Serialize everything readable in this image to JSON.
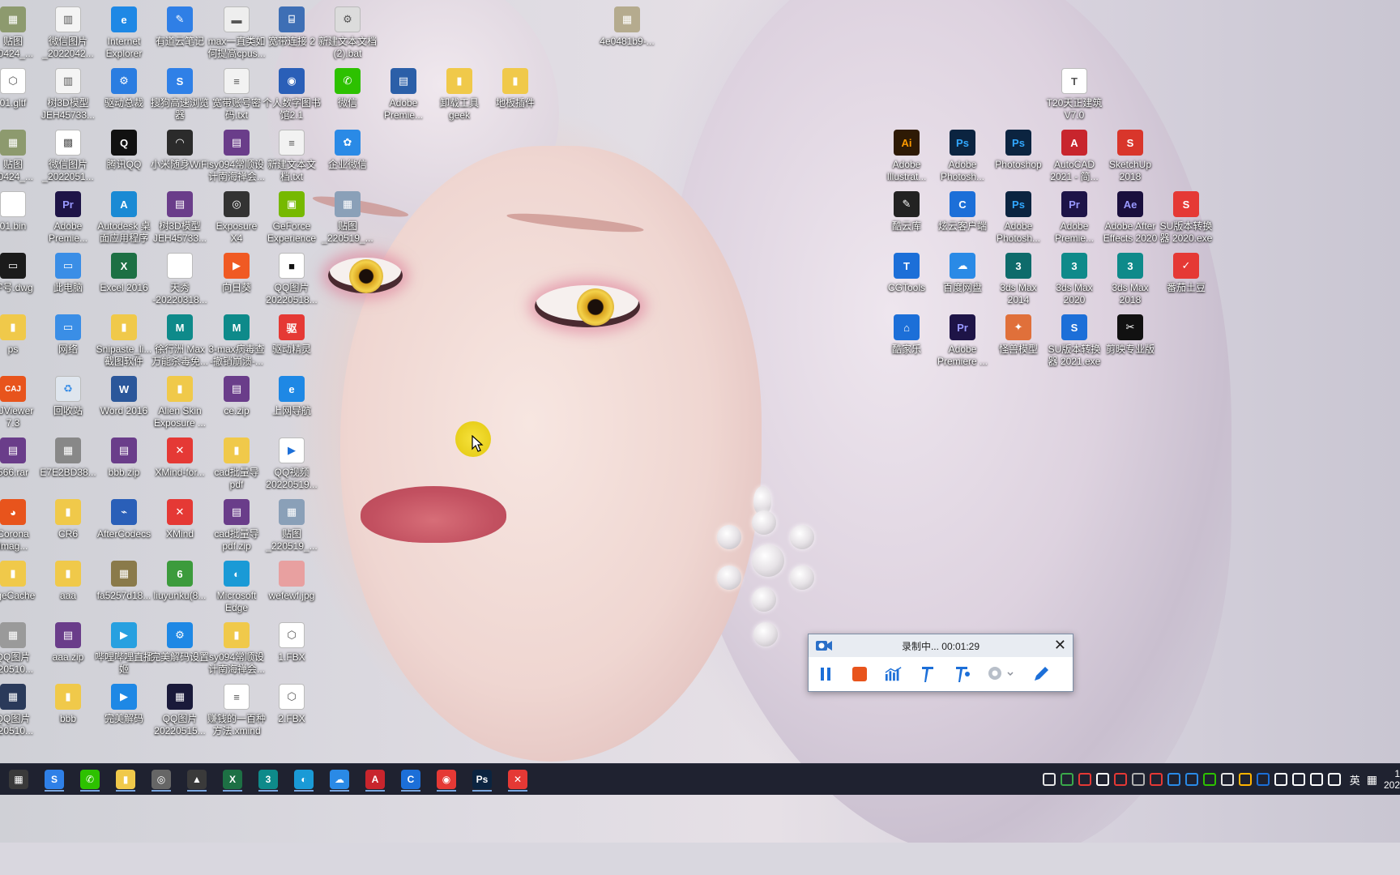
{
  "desktop": {
    "icons": [
      {
        "id": "tietu-1",
        "label": "贴图\n20424_...",
        "color": "#8d9a6e",
        "glyph": "▦"
      },
      {
        "id": "wx-img-1",
        "label": "微信图片\n_2022042...",
        "color": "#f4f4f4",
        "glyph": "▥"
      },
      {
        "id": "ie",
        "label": "Internet\nExplorer",
        "color": "#1e88e5",
        "glyph": "e"
      },
      {
        "id": "youdao",
        "label": "有道云笔记",
        "color": "#2f7fe6",
        "glyph": "✎"
      },
      {
        "id": "max-cpu",
        "label": "max一直类如\n何提高cpus...",
        "color": "#eeeeee",
        "glyph": "▬"
      },
      {
        "id": "broadband2",
        "label": "宽带连接 2",
        "color": "#3e6fb5",
        "glyph": "⌸"
      },
      {
        "id": "new-bat",
        "label": "新建文本文档\n(2).bat",
        "color": "#dcdcdc",
        "glyph": "⚙"
      },
      {
        "id": "hash-img",
        "label": "4e0481b9-...",
        "color": "#b5ab8e",
        "glyph": "▦"
      },
      {
        "id": "gltf",
        "label": "01.gltf",
        "color": "#ffffff",
        "glyph": "⬡"
      },
      {
        "id": "tree3d-1",
        "label": "树3D模型\nJEH45733...",
        "color": "#f4f4f4",
        "glyph": "▥"
      },
      {
        "id": "driver-master",
        "label": "驱动总裁",
        "color": "#2a7de1",
        "glyph": "⚙"
      },
      {
        "id": "sogou-browser",
        "label": "搜狗高速浏览\n器",
        "color": "#2f80e7",
        "glyph": "S"
      },
      {
        "id": "broadband-pw",
        "label": "宽带账号密\n码.txt",
        "color": "#f2f2f2",
        "glyph": "≡"
      },
      {
        "id": "personal-lib",
        "label": "个人数字图书\n馆2.1",
        "color": "#2a5fb8",
        "glyph": "◉"
      },
      {
        "id": "wechat",
        "label": "微信",
        "color": "#2dc100",
        "glyph": "✆"
      },
      {
        "id": "premiere-a",
        "label": "Adobe\nPremie...",
        "color": "#2b5fa8",
        "glyph": "▤"
      },
      {
        "id": "geek",
        "label": "卸载工具\ngeek",
        "color": "#f0c94a",
        "glyph": "▮"
      },
      {
        "id": "floor-pack",
        "label": "地板插件",
        "color": "#f0c94a",
        "glyph": "▮"
      },
      {
        "id": "t20",
        "label": "T20天正建筑\nV7.0",
        "color": "#ffffff",
        "glyph": "T"
      },
      {
        "id": "tietu-2",
        "label": "贴图\n20424_...",
        "color": "#8d9a6e",
        "glyph": "▦"
      },
      {
        "id": "wx-img-2",
        "label": "微信图片\n_2022051...",
        "color": "#ffffff",
        "glyph": "▩"
      },
      {
        "id": "qq",
        "label": "腾讯QQ",
        "color": "#111111",
        "glyph": "Q"
      },
      {
        "id": "mi-wifi",
        "label": "小米随身WiFi",
        "color": "#2b2b2b",
        "glyph": "◠"
      },
      {
        "id": "sy094-1",
        "label": "sy094常顺设\n计南海禅会...",
        "color": "#6a3d8a",
        "glyph": "▤"
      },
      {
        "id": "new-txt",
        "label": "新建文本文\n档.txt",
        "color": "#f2f2f2",
        "glyph": "≡"
      },
      {
        "id": "wecom",
        "label": "企业微信",
        "color": "#2a8ae6",
        "glyph": "✿"
      },
      {
        "id": "illustrator",
        "label": "Adobe\nIllustrat...",
        "color": "#2e1a05",
        "glyph": "Ai",
        "fg": "#ff9a00"
      },
      {
        "id": "photoshop-a",
        "label": "Adobe\nPhotosh...",
        "color": "#0b2440",
        "glyph": "Ps",
        "fg": "#31a8ff"
      },
      {
        "id": "photoshop",
        "label": "Photoshop",
        "color": "#0b2440",
        "glyph": "Ps",
        "fg": "#31a8ff"
      },
      {
        "id": "autocad",
        "label": "AutoCAD\n2021 - 简...",
        "color": "#c8252d",
        "glyph": "A"
      },
      {
        "id": "sketchup",
        "label": "SketchUp\n2018",
        "color": "#d9362b",
        "glyph": "S"
      },
      {
        "id": "bin",
        "label": "01.bin",
        "color": "#ffffff",
        "glyph": ""
      },
      {
        "id": "premiere-b",
        "label": "Adobe\nPremie...",
        "color": "#1e1447",
        "glyph": "Pr",
        "fg": "#9999ff"
      },
      {
        "id": "autodesk-app",
        "label": "Autodesk 桌\n面应用程序",
        "color": "#1a8ad4",
        "glyph": "A"
      },
      {
        "id": "tree3d-2",
        "label": "树3D模型\nJEH45733...",
        "color": "#6a3d8a",
        "glyph": "▤"
      },
      {
        "id": "exposure",
        "label": "Exposure\nX4",
        "color": "#333333",
        "glyph": "◎"
      },
      {
        "id": "geforce",
        "label": "GeForce\nExperience",
        "color": "#76b900",
        "glyph": "▣"
      },
      {
        "id": "tietu-3",
        "label": "贴图\n_220519_...",
        "color": "#8aa0b8",
        "glyph": "▦"
      },
      {
        "id": "coolwood",
        "label": "酷云库",
        "color": "#222222",
        "glyph": "✎"
      },
      {
        "id": "xuanyun",
        "label": "炫云客户端",
        "color": "#1c6fd8",
        "glyph": "C"
      },
      {
        "id": "photoshop-b",
        "label": "Adobe\nPhotosh...",
        "color": "#0b2440",
        "glyph": "Ps",
        "fg": "#31a8ff"
      },
      {
        "id": "premiere-c",
        "label": "Adobe\nPremie...",
        "color": "#1e1447",
        "glyph": "Pr",
        "fg": "#9999ff"
      },
      {
        "id": "after-effects",
        "label": "Adobe After\nEffects 2020",
        "color": "#1a0f3d",
        "glyph": "Ae",
        "fg": "#9999ff"
      },
      {
        "id": "su-2020",
        "label": "SU版本转换\n器 2020.exe",
        "color": "#e53935",
        "glyph": "S"
      },
      {
        "id": "dwg",
        "label": "字号.dwg",
        "color": "#1b1b1b",
        "glyph": "▭"
      },
      {
        "id": "this-pc",
        "label": "此电脑",
        "color": "#3a8ee6",
        "glyph": "▭"
      },
      {
        "id": "excel",
        "label": "Excel 2016",
        "color": "#1d7044",
        "glyph": "X"
      },
      {
        "id": "tianxiu",
        "label": "天秀\n-20220318...",
        "color": "#ffffff",
        "glyph": ""
      },
      {
        "id": "sunflower",
        "label": "向日葵",
        "color": "#f05a23",
        "glyph": "▶"
      },
      {
        "id": "qq-img-1",
        "label": "QQ图片\n20220518...",
        "color": "#ffffff",
        "glyph": "■",
        "fg": "#111111"
      },
      {
        "id": "cgtools",
        "label": "CGTools",
        "color": "#1c6fd8",
        "glyph": "T"
      },
      {
        "id": "baidu-pan",
        "label": "百度网盘",
        "color": "#2a8ae6",
        "glyph": "☁"
      },
      {
        "id": "3dsmax2014",
        "label": "3ds Max\n2014",
        "color": "#0e6b6b",
        "glyph": "3"
      },
      {
        "id": "3dsmax2020",
        "label": "3ds Max\n2020",
        "color": "#0e8a8a",
        "glyph": "3"
      },
      {
        "id": "3dsmax2018",
        "label": "3ds Max\n2018",
        "color": "#0e8a8a",
        "glyph": "3"
      },
      {
        "id": "tomato",
        "label": "番茄土豆",
        "color": "#e53935",
        "glyph": "✓"
      },
      {
        "id": "ps-folder",
        "label": "ps",
        "color": "#f0c94a",
        "glyph": "▮"
      },
      {
        "id": "network",
        "label": "网络",
        "color": "#3a8ee6",
        "glyph": "▭"
      },
      {
        "id": "snipaste",
        "label": "Snipaste_li...\n截图软件",
        "color": "#f0c94a",
        "glyph": "▮"
      },
      {
        "id": "xu-max",
        "label": "徐行洲 Max\n万能杀毒免...",
        "color": "#0e8a8a",
        "glyph": "M"
      },
      {
        "id": "max-virus",
        "label": "3-max病毒查\n-撤销崩溃-...",
        "color": "#0e8a8a",
        "glyph": "M"
      },
      {
        "id": "driver-genius",
        "label": "驱动精灵",
        "color": "#e53935",
        "glyph": "驱"
      },
      {
        "id": "kujiale",
        "label": "酷家乐",
        "color": "#1c6fd8",
        "glyph": "⌂"
      },
      {
        "id": "premiere-d",
        "label": "Adobe\nPremiere ...",
        "color": "#1e1447",
        "glyph": "Pr",
        "fg": "#9999ff"
      },
      {
        "id": "guaiwu",
        "label": "怪兽模型",
        "color": "#e0703a",
        "glyph": "✦"
      },
      {
        "id": "su-2021",
        "label": "SU版本转换\n器 2021.exe",
        "color": "#1c6fd8",
        "glyph": "S"
      },
      {
        "id": "capcut",
        "label": "剪映专业版",
        "color": "#111111",
        "glyph": "✂"
      },
      {
        "id": "caj",
        "label": "AJViewer\n7.3",
        "color": "#e8541c",
        "glyph": "CAJ"
      },
      {
        "id": "recycle-bin",
        "label": "回收站",
        "color": "#dfe6ee",
        "glyph": "♻",
        "fg": "#3a8ee6"
      },
      {
        "id": "word",
        "label": "Word 2016",
        "color": "#2b579a",
        "glyph": "W"
      },
      {
        "id": "alien-skin",
        "label": "Alien Skin\nExposure ...",
        "color": "#f0c94a",
        "glyph": "▮"
      },
      {
        "id": "ce-zip",
        "label": "ce.zip",
        "color": "#6a3d8a",
        "glyph": "▤"
      },
      {
        "id": "web-nav",
        "label": "上网导航",
        "color": "#1e88e5",
        "glyph": "e"
      },
      {
        "id": "rar566",
        "label": "566.rar",
        "color": "#6a3d8a",
        "glyph": "▤"
      },
      {
        "id": "e7e2",
        "label": "E7E2BD38...",
        "color": "#888888",
        "glyph": "▦"
      },
      {
        "id": "bbb-zip",
        "label": "bbb.zip",
        "color": "#6a3d8a",
        "glyph": "▤"
      },
      {
        "id": "xmind-for",
        "label": "XMind-for...",
        "color": "#e53935",
        "glyph": "✕"
      },
      {
        "id": "cad-pdf",
        "label": "cad批量导\npdf",
        "color": "#f0c94a",
        "glyph": "▮"
      },
      {
        "id": "qq-video",
        "label": "QQ视频\n20220519...",
        "color": "#ffffff",
        "glyph": "▶",
        "fg": "#1c6fd8"
      },
      {
        "id": "corona",
        "label": "Corona\nImag...",
        "color": "#e8541c",
        "glyph": "◕"
      },
      {
        "id": "cr6",
        "label": "CR6",
        "color": "#f0c94a",
        "glyph": "▮"
      },
      {
        "id": "aftercodecs",
        "label": "AfterCodecs",
        "color": "#2a5fb8",
        "glyph": "⌁"
      },
      {
        "id": "xmind",
        "label": "XMind",
        "color": "#e53935",
        "glyph": "✕"
      },
      {
        "id": "cad-pdf-zip",
        "label": "cad批量导\npdf.zip",
        "color": "#6a3d8a",
        "glyph": "▤"
      },
      {
        "id": "tietu-4",
        "label": "贴图\n_220519_...",
        "color": "#8aa0b8",
        "glyph": "▦"
      },
      {
        "id": "pagecache",
        "label": "ageCache",
        "color": "#f0c94a",
        "glyph": "▮"
      },
      {
        "id": "aaa",
        "label": "aaa",
        "color": "#f0c94a",
        "glyph": "▮"
      },
      {
        "id": "fa5257",
        "label": "fa5257d18...",
        "color": "#8a7a4a",
        "glyph": "▦"
      },
      {
        "id": "liuyunku",
        "label": "liuyunku(8...",
        "color": "#3c9b3c",
        "glyph": "6"
      },
      {
        "id": "edge",
        "label": "Microsoft\nEdge",
        "color": "#1a9ad6",
        "glyph": "◐"
      },
      {
        "id": "wefewf",
        "label": "wefewf.jpg",
        "color": "#e8a0a0",
        "glyph": ""
      },
      {
        "id": "qq-img-2",
        "label": "QQ图片\n220510...",
        "color": "#9a9a9a",
        "glyph": "▦"
      },
      {
        "id": "aaa-zip",
        "label": "aaa.zip",
        "color": "#6a3d8a",
        "glyph": "▤"
      },
      {
        "id": "bilibili-live",
        "label": "哔哩哔哩直播\n姬",
        "color": "#27a0e0",
        "glyph": "▶"
      },
      {
        "id": "perfect-decode-set",
        "label": "完美解码设置",
        "color": "#1e88e5",
        "glyph": "⚙"
      },
      {
        "id": "sy094-2",
        "label": "sy094常顺设\n计南海禅会...",
        "color": "#f0c94a",
        "glyph": "▮"
      },
      {
        "id": "fbx1",
        "label": "1.FBX",
        "color": "#ffffff",
        "glyph": "⬡"
      },
      {
        "id": "qq-img-3",
        "label": "QQ图片\n220510...",
        "color": "#2a3a5a",
        "glyph": "▦"
      },
      {
        "id": "bbb",
        "label": "bbb",
        "color": "#f0c94a",
        "glyph": "▮"
      },
      {
        "id": "perfect-decode",
        "label": "完美解码",
        "color": "#1e88e5",
        "glyph": "▶"
      },
      {
        "id": "qq-img-4",
        "label": "QQ图片\n20220515...",
        "color": "#1a1a3a",
        "glyph": "▦"
      },
      {
        "id": "xmind-money",
        "label": "赚钱的一百种\n方法.xmind",
        "color": "#ffffff",
        "glyph": "≡"
      },
      {
        "id": "fbx2",
        "label": "2.FBX",
        "color": "#ffffff",
        "glyph": "⬡"
      }
    ]
  },
  "recorder": {
    "status": "录制中... 00:01:29",
    "tools": [
      "pause-icon",
      "stop-icon",
      "chart-icon",
      "pen-icon",
      "pen-plus-icon",
      "webcam-icon",
      "draw-icon"
    ],
    "colors": {
      "pause": "#1c6fd8",
      "stop": "#e8541c"
    }
  },
  "taskbar": {
    "apps": [
      {
        "id": "calculator",
        "color": "#3a3a3a",
        "glyph": "▦"
      },
      {
        "id": "sogou",
        "color": "#2f80e7",
        "glyph": "S"
      },
      {
        "id": "wechat",
        "color": "#2dc100",
        "glyph": "✆"
      },
      {
        "id": "explorer",
        "color": "#f0c94a",
        "glyph": "▮"
      },
      {
        "id": "exposure",
        "color": "#666666",
        "glyph": "◎"
      },
      {
        "id": "photos",
        "color": "#3a3a3a",
        "glyph": "▲"
      },
      {
        "id": "excel",
        "color": "#1d7044",
        "glyph": "X"
      },
      {
        "id": "3dsmax",
        "color": "#0e8a8a",
        "glyph": "3"
      },
      {
        "id": "edge",
        "color": "#1a9ad6",
        "glyph": "◐"
      },
      {
        "id": "baidu-pan",
        "color": "#2a8ae6",
        "glyph": "☁"
      },
      {
        "id": "autocad",
        "color": "#c8252d",
        "glyph": "A"
      },
      {
        "id": "xuanyun",
        "color": "#1c6fd8",
        "glyph": "C"
      },
      {
        "id": "netease-music",
        "color": "#e53935",
        "glyph": "◉"
      },
      {
        "id": "photoshop",
        "color": "#0b2440",
        "glyph": "Ps"
      },
      {
        "id": "xmind",
        "color": "#e53935",
        "glyph": "✕"
      }
    ],
    "ime": "英",
    "clock_time": "1",
    "clock_date": "202"
  }
}
